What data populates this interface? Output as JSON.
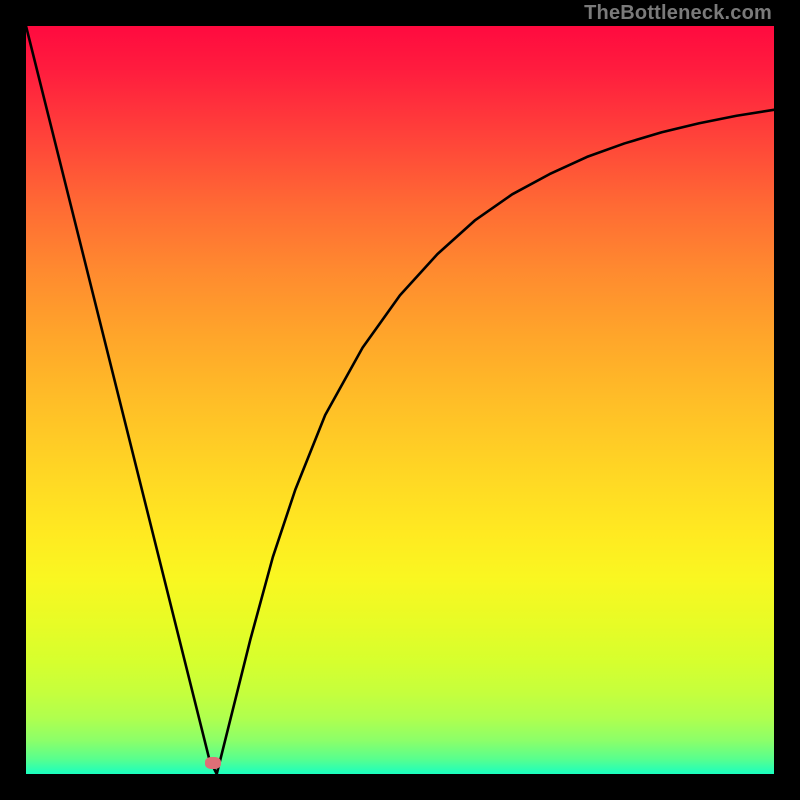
{
  "watermark": "TheBottleneck.com",
  "chart_data": {
    "type": "line",
    "title": "",
    "xlabel": "",
    "ylabel": "",
    "xlim": [
      0,
      100
    ],
    "ylim": [
      0,
      100
    ],
    "grid": false,
    "legend": false,
    "x": [
      0,
      3,
      6,
      9,
      12,
      15,
      18,
      21,
      23.5,
      24.5,
      25.5,
      27,
      30,
      33,
      36,
      40,
      45,
      50,
      55,
      60,
      65,
      70,
      75,
      80,
      85,
      90,
      95,
      100
    ],
    "values": [
      100,
      88,
      76,
      64,
      52,
      40,
      28,
      16,
      6,
      2,
      0,
      6,
      18,
      29,
      38,
      48,
      57,
      64,
      69.5,
      74,
      77.5,
      80.2,
      82.5,
      84.3,
      85.8,
      87,
      88,
      88.8
    ],
    "marker": {
      "x": 25,
      "y": 1.5
    },
    "background_gradient": {
      "type": "vertical",
      "stops": [
        {
          "pos": 0,
          "color": "#ff0a3f"
        },
        {
          "pos": 100,
          "color": "#1affc0"
        }
      ]
    }
  }
}
